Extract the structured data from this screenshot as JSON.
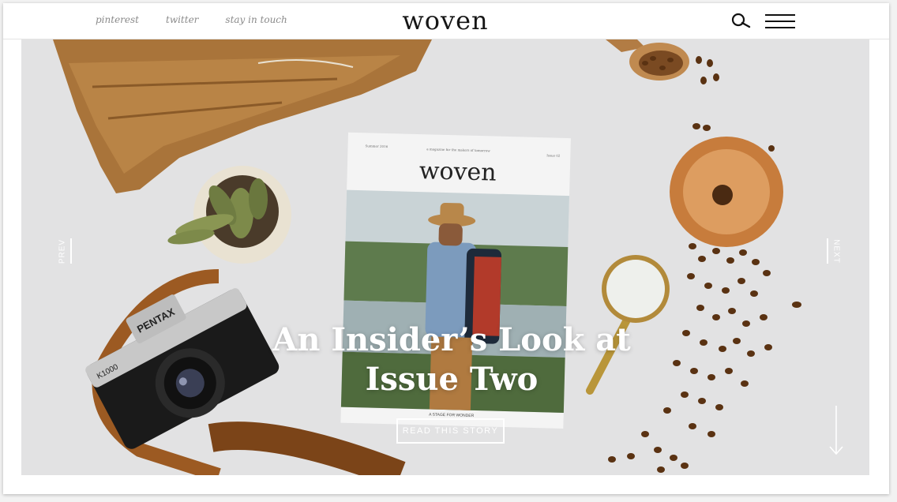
{
  "header": {
    "social_links": [
      "pinterest",
      "twitter",
      "stay in touch"
    ],
    "logo": "woven"
  },
  "hero": {
    "headline_line1": "An Insider’s Look at",
    "headline_line2": "Issue Two",
    "cta_label": "READ THIS STORY",
    "prev_label": "PREV",
    "next_label": "NEXT"
  },
  "magazine": {
    "title": "woven",
    "tagline": "A STAGE FOR WONDER",
    "issue_left": "Summer 2016",
    "issue_right": "Issue 02",
    "subtitle": "a magazine for the makers of tomorrow"
  },
  "camera": {
    "brand": "PENTAX",
    "model": "K1000"
  },
  "icons": [
    "search-icon",
    "menu-icon",
    "scroll-down-arrow-icon"
  ],
  "colors": {
    "background": "#e2e2e3",
    "logo": "#161616",
    "social_link": "#8a8a8a",
    "overlay_text": "#ffffff"
  }
}
